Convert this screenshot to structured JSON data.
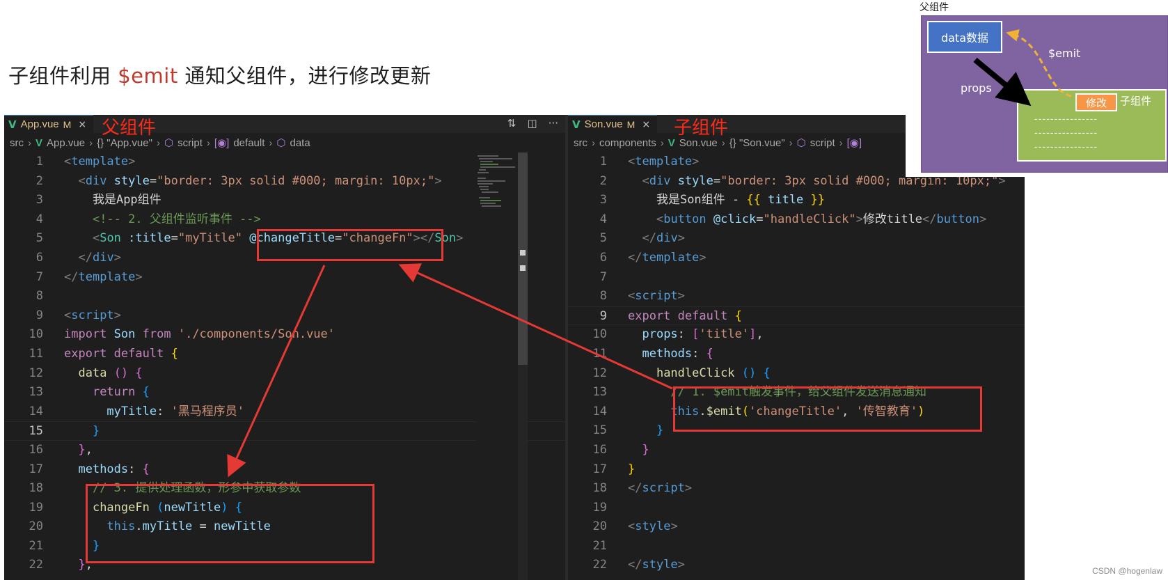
{
  "slide": {
    "title_prefix": "子组件利用 ",
    "title_highlight": "$emit",
    "title_suffix": " 通知父组件，进行修改更新"
  },
  "left_editor": {
    "tab": {
      "filename": "App.vue",
      "modified": "M",
      "close": "×",
      "note": "父组件"
    },
    "actions": [
      "compare-icon",
      "split-editor-icon",
      "more-icon"
    ],
    "breadcrumb": [
      "src",
      "App.vue",
      "{} \"App.vue\"",
      "script",
      "default",
      "data"
    ],
    "lines": [
      {
        "n": "1"
      },
      {
        "n": "2"
      },
      {
        "n": "3"
      },
      {
        "n": "4"
      },
      {
        "n": "5"
      },
      {
        "n": "6"
      },
      {
        "n": "7"
      },
      {
        "n": "8"
      },
      {
        "n": "9"
      },
      {
        "n": "10"
      },
      {
        "n": "11"
      },
      {
        "n": "12"
      },
      {
        "n": "13"
      },
      {
        "n": "14"
      },
      {
        "n": "15"
      },
      {
        "n": "16"
      },
      {
        "n": "17"
      },
      {
        "n": "18"
      },
      {
        "n": "19"
      },
      {
        "n": "20"
      },
      {
        "n": "21"
      },
      {
        "n": "22"
      }
    ],
    "code": {
      "l1": "<template>",
      "l3": "我是App组件",
      "l4": "<!-- 2. 父组件监听事件 -->",
      "l14_str": "'黑马程序员'",
      "l18": "// 3. 提供处理函数，形参中获取参数"
    }
  },
  "right_editor": {
    "tab": {
      "filename": "Son.vue",
      "modified": "M",
      "close": "×",
      "note": "子组件"
    },
    "breadcrumb": [
      "src",
      "components",
      "Son.vue",
      "{} \"Son.vue\"",
      "script"
    ],
    "lines": [
      {
        "n": "1"
      },
      {
        "n": "2"
      },
      {
        "n": "3"
      },
      {
        "n": "4"
      },
      {
        "n": "5"
      },
      {
        "n": "6"
      },
      {
        "n": "7"
      },
      {
        "n": "8"
      },
      {
        "n": "9"
      },
      {
        "n": "10"
      },
      {
        "n": "11"
      },
      {
        "n": "12"
      },
      {
        "n": "13"
      },
      {
        "n": "14"
      },
      {
        "n": "15"
      },
      {
        "n": "16"
      },
      {
        "n": "17"
      },
      {
        "n": "18"
      },
      {
        "n": "19"
      },
      {
        "n": "20"
      },
      {
        "n": "21"
      },
      {
        "n": "22"
      }
    ],
    "code": {
      "l3": "我是Son组件 - ",
      "l4_btn_text": "修改title",
      "l13": "// 1. $emit触发事件，给父组件发送消息通知",
      "l14_str2": "'传智教育'"
    }
  },
  "diagram": {
    "parent_label": "父组件",
    "data_label": "data数据",
    "emit_label": "$emit",
    "props_label": "props",
    "edit_label": "修改",
    "son_label": "子组件",
    "dash_line": "----------------"
  },
  "watermark": "CSDN @hogenlaw",
  "colors": {
    "highlight_red": "#e53935",
    "title_red": "#c0392b",
    "editor_bg": "#1e1e1e"
  }
}
